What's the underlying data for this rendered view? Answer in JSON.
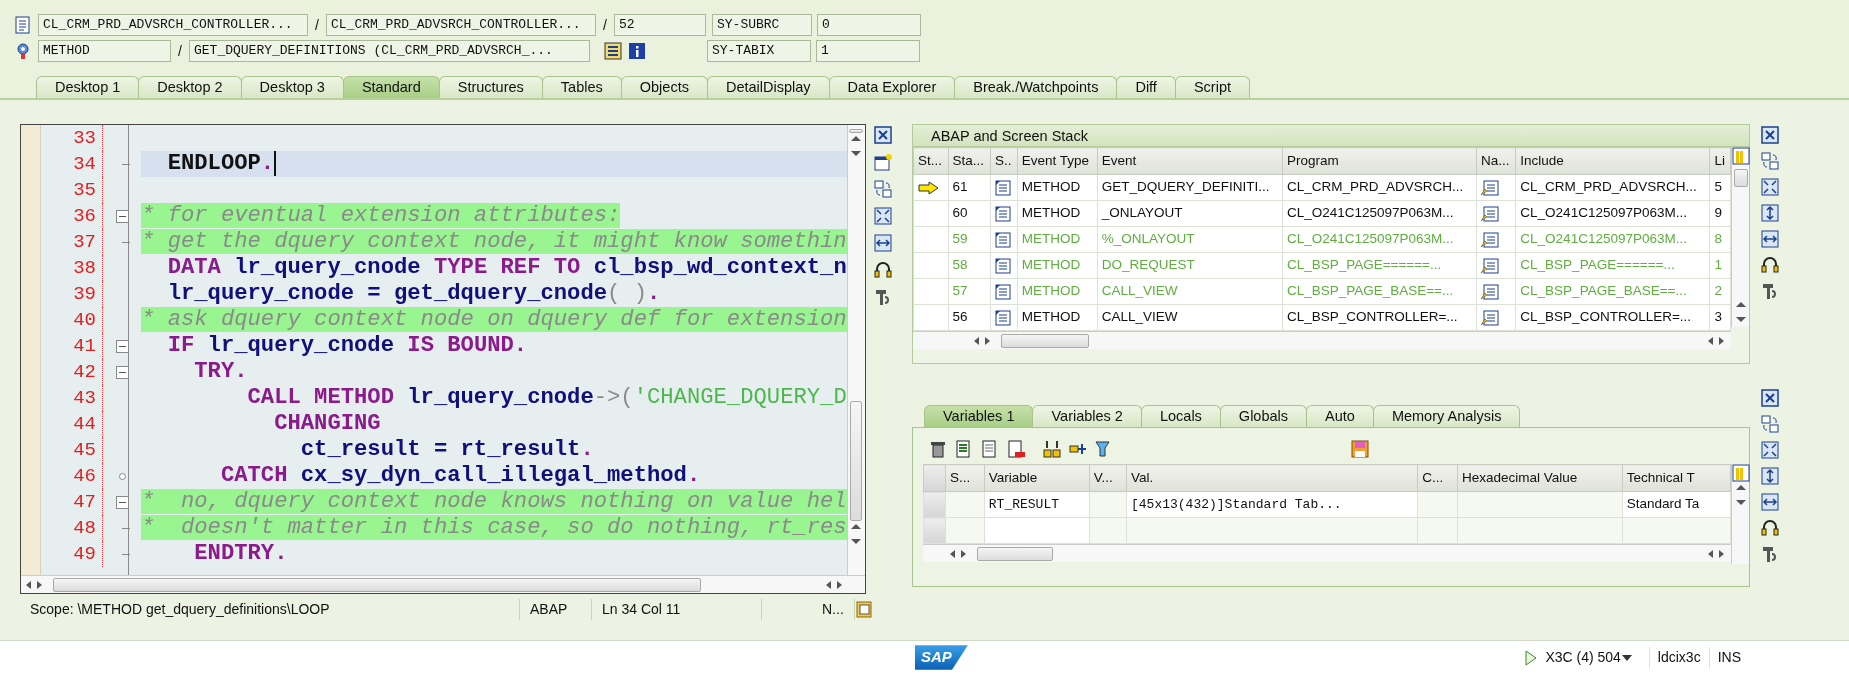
{
  "header": {
    "separator": "/",
    "fields_row1": [
      "CL_CRM_PRD_ADVSRCH_CONTROLLER...",
      "CL_CRM_PRD_ADVSRCH_CONTROLLER...",
      "52"
    ],
    "fields_row2": [
      "METHOD",
      "GET_DQUERY_DEFINITIONS (CL_CRM_PRD_ADVSRCH_..."
    ],
    "sysvars": [
      {
        "name": "SY-SUBRC",
        "value": "0"
      },
      {
        "name": "SY-TABIX",
        "value": "1"
      }
    ]
  },
  "tabs": [
    {
      "label": "Desktop 1",
      "selected": false
    },
    {
      "label": "Desktop 2",
      "selected": false
    },
    {
      "label": "Desktop 3",
      "selected": false
    },
    {
      "label": "Standard",
      "selected": true
    },
    {
      "label": "Structures",
      "selected": false
    },
    {
      "label": "Tables",
      "selected": false
    },
    {
      "label": "Objects",
      "selected": false
    },
    {
      "label": "DetailDisplay",
      "selected": false
    },
    {
      "label": "Data Explorer",
      "selected": false
    },
    {
      "label": "Break./Watchpoints",
      "selected": false
    },
    {
      "label": "Diff",
      "selected": false
    },
    {
      "label": "Script",
      "selected": false
    }
  ],
  "code": {
    "lines": [
      {
        "number": "33",
        "kind": "plain",
        "current": false
      },
      {
        "number": "34",
        "kind": "fold-end",
        "current": true,
        "tokens": [
          {
            "kind": "plain",
            "text": "  ENDLOOP"
          },
          {
            "kind": "keyword",
            "text": "."
          }
        ]
      },
      {
        "number": "35",
        "kind": "plain",
        "current": false
      },
      {
        "number": "36",
        "kind": "fold-start",
        "current": false,
        "tokens": [
          {
            "kind": "comment",
            "text": "* for eventual extension attributes:"
          }
        ]
      },
      {
        "number": "37",
        "kind": "fold-end",
        "current": false,
        "tokens": [
          {
            "kind": "comment",
            "text": "* get the dquery context node, it might know somethin"
          }
        ]
      },
      {
        "number": "38",
        "kind": "plain",
        "current": false,
        "tokens": [
          {
            "kind": "keyword",
            "text": "  DATA"
          },
          {
            "kind": "name",
            "text": " lr_query_cnode"
          },
          {
            "kind": "keyword",
            "text": " TYPE REF TO"
          },
          {
            "kind": "name",
            "text": " cl_bsp_wd_context_n"
          }
        ]
      },
      {
        "number": "39",
        "kind": "plain",
        "current": false,
        "tokens": [
          {
            "kind": "name",
            "text": "  lr_query_cnode = get_dquery_cnode"
          },
          {
            "kind": "punct",
            "text": "( )"
          },
          {
            "kind": "keyword",
            "text": "."
          }
        ]
      },
      {
        "number": "40",
        "kind": "plain",
        "current": false,
        "tokens": [
          {
            "kind": "comment",
            "text": "* ask dquery context node on dquery def for extension"
          }
        ]
      },
      {
        "number": "41",
        "kind": "fold-start",
        "current": false,
        "tokens": [
          {
            "kind": "keyword",
            "text": "  IF"
          },
          {
            "kind": "name",
            "text": " lr_query_cnode"
          },
          {
            "kind": "keyword",
            "text": " IS BOUND."
          }
        ]
      },
      {
        "number": "42",
        "kind": "fold-start",
        "current": false,
        "tokens": [
          {
            "kind": "keyword",
            "text": "    TRY."
          }
        ]
      },
      {
        "number": "43",
        "kind": "plain",
        "current": false,
        "tokens": [
          {
            "kind": "keyword",
            "text": "        CALL METHOD"
          },
          {
            "kind": "name",
            "text": " lr_query_cnode"
          },
          {
            "kind": "punct",
            "text": "->("
          },
          {
            "kind": "literal",
            "text": "'CHANGE_DQUERY_D"
          }
        ]
      },
      {
        "number": "44",
        "kind": "plain",
        "current": false,
        "tokens": [
          {
            "kind": "keyword",
            "text": "          CHANGING"
          }
        ]
      },
      {
        "number": "45",
        "kind": "plain",
        "current": false,
        "tokens": [
          {
            "kind": "name",
            "text": "            ct_result = rt_result"
          },
          {
            "kind": "keyword",
            "text": "."
          }
        ]
      },
      {
        "number": "46",
        "kind": "branch",
        "current": false,
        "tokens": [
          {
            "kind": "keyword",
            "text": "      CATCH"
          },
          {
            "kind": "name",
            "text": " cx_sy_dyn_call_illegal_method"
          },
          {
            "kind": "keyword",
            "text": "."
          }
        ]
      },
      {
        "number": "47",
        "kind": "fold-start",
        "current": false,
        "tokens": [
          {
            "kind": "comment",
            "text": "*  no, dquery context node knows nothing on value hel"
          }
        ]
      },
      {
        "number": "48",
        "kind": "fold-end",
        "current": false,
        "tokens": [
          {
            "kind": "comment",
            "text": "*  doesn't matter in this case, so do nothing, rt_res"
          }
        ]
      },
      {
        "number": "49",
        "kind": "fold-end",
        "current": false,
        "tokens": [
          {
            "kind": "keyword",
            "text": "    ENDTRY."
          }
        ]
      }
    ],
    "status": {
      "scope": "Scope: \\METHOD get_dquery_definitions\\LOOP",
      "language": "ABAP",
      "position": "Ln  34 Col  11",
      "mode": "N..."
    }
  },
  "stack": {
    "title": "ABAP and Screen Stack",
    "columns": [
      "St...",
      "Sta...",
      "S..",
      "Event Type",
      "Event",
      "Program",
      "Na...",
      "Include",
      "Li"
    ],
    "rows": [
      {
        "current": true,
        "dimmed": false,
        "level": "61",
        "event_type": "METHOD",
        "event": "GET_DQUERY_DEFINITI...",
        "program": "CL_CRM_PRD_ADVSRCH...",
        "include": "CL_CRM_PRD_ADVSRCH...",
        "line": "5"
      },
      {
        "current": false,
        "dimmed": false,
        "level": "60",
        "event_type": "METHOD",
        "event": "_ONLAYOUT",
        "program": "CL_O241C125097P063M...",
        "include": "CL_O241C125097P063M...",
        "line": "9"
      },
      {
        "current": false,
        "dimmed": true,
        "level": "59",
        "event_type": "METHOD",
        "event": "%_ONLAYOUT",
        "program": "CL_O241C125097P063M...",
        "include": "CL_O241C125097P063M...",
        "line": "8"
      },
      {
        "current": false,
        "dimmed": true,
        "level": "58",
        "event_type": "METHOD",
        "event": "DO_REQUEST",
        "program": "CL_BSP_PAGE======...",
        "include": "CL_BSP_PAGE======...",
        "line": "1"
      },
      {
        "current": false,
        "dimmed": true,
        "level": "57",
        "event_type": "METHOD",
        "event": "CALL_VIEW",
        "program": "CL_BSP_PAGE_BASE==...",
        "include": "CL_BSP_PAGE_BASE==...",
        "line": "2"
      },
      {
        "current": false,
        "dimmed": false,
        "level": "56",
        "event_type": "METHOD",
        "event": "CALL_VIEW",
        "program": "CL_BSP_CONTROLLER=...",
        "include": "CL_BSP_CONTROLLER=...",
        "line": "3"
      }
    ]
  },
  "variables": {
    "tabs": [
      {
        "label": "Variables 1",
        "selected": true
      },
      {
        "label": "Variables 2",
        "selected": false
      },
      {
        "label": "Locals",
        "selected": false
      },
      {
        "label": "Globals",
        "selected": false
      },
      {
        "label": "Auto",
        "selected": false
      },
      {
        "label": "Memory Analysis",
        "selected": false
      }
    ],
    "columns": [
      "S...",
      "Variable",
      "V...",
      "Val.",
      "C...",
      "Hexadecimal Value",
      "Technical T"
    ],
    "rows": [
      {
        "kind": "entry",
        "variable": "RT_RESULT",
        "value": "[45x13(432)]Standard Tab...",
        "technical_type": "Standard Ta"
      },
      {
        "kind": "blank"
      }
    ]
  },
  "status_bar": {
    "logo": "SAP",
    "system": "X3C (4) 504",
    "server": "ldcix3c",
    "mode": "INS"
  }
}
